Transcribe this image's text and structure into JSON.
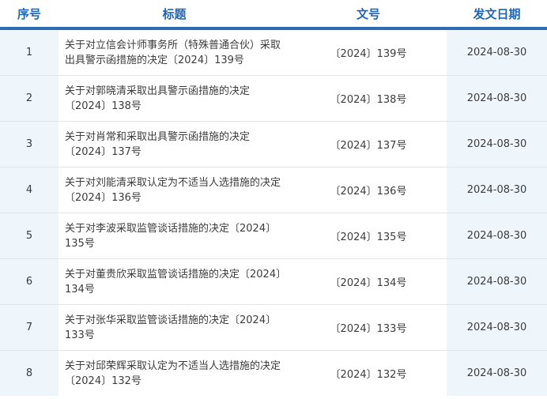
{
  "headers": {
    "number": "序号",
    "title": "标题",
    "doc_no": "文号",
    "date": "发文日期"
  },
  "rows": [
    {
      "number": "1",
      "title": "关于对立信会计师事务所（特殊普通合伙）采取出具警示函措施的决定〔2024〕139号",
      "doc_no": "〔2024〕139号",
      "date": "2024-08-30"
    },
    {
      "number": "2",
      "title": "关于对郭晓清采取出具警示函措施的决定〔2024〕138号",
      "doc_no": "〔2024〕138号",
      "date": "2024-08-30"
    },
    {
      "number": "3",
      "title": "关于对肖常和采取出具警示函措施的决定〔2024〕137号",
      "doc_no": "〔2024〕137号",
      "date": "2024-08-30"
    },
    {
      "number": "4",
      "title": "关于对刘能清采取认定为不适当人选措施的决定〔2024〕136号",
      "doc_no": "〔2024〕136号",
      "date": "2024-08-30"
    },
    {
      "number": "5",
      "title": "关于对李波采取监管谈话措施的决定〔2024〕135号",
      "doc_no": "〔2024〕135号",
      "date": "2024-08-30"
    },
    {
      "number": "6",
      "title": "关于对董贵欣采取监管谈话措施的决定〔2024〕134号",
      "doc_no": "〔2024〕134号",
      "date": "2024-08-30"
    },
    {
      "number": "7",
      "title": "关于对张华采取监管谈话措施的决定〔2024〕133号",
      "doc_no": "〔2024〕133号",
      "date": "2024-08-30"
    },
    {
      "number": "8",
      "title": "关于对邱荣辉采取认定为不适当人选措施的决定〔2024〕132号",
      "doc_no": "〔2024〕132号",
      "date": "2024-08-30"
    }
  ]
}
